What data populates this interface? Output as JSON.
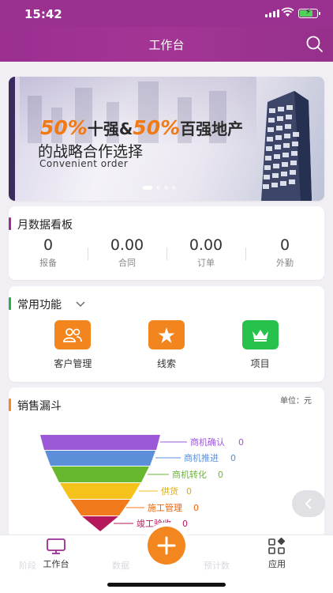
{
  "status_bar": {
    "time": "15:42"
  },
  "header": {
    "title": "工作台"
  },
  "banner": {
    "line1_pct_a": "50%",
    "line1_text_a": "十强&",
    "line1_pct_b": "50%",
    "line1_text_b": "百强地产",
    "line2": "的战略合作选择",
    "subtitle": "Convenient order"
  },
  "monthly": {
    "title": "月数据看板",
    "stats": [
      {
        "value": "0",
        "label": "报备"
      },
      {
        "value": "0.00",
        "label": "合同"
      },
      {
        "value": "0.00",
        "label": "订单"
      },
      {
        "value": "0",
        "label": "外勤"
      }
    ]
  },
  "common": {
    "title": "常用功能",
    "items": [
      {
        "label": "客户管理",
        "icon": "people-icon",
        "color": "#f2851e"
      },
      {
        "label": "线索",
        "icon": "person-star-icon",
        "color": "#f2851e"
      },
      {
        "label": "项目",
        "icon": "crown-icon",
        "color": "#27c24c"
      }
    ]
  },
  "funnel": {
    "title": "销售漏斗",
    "unit": "单位：元",
    "stages": [
      {
        "label": "商机确认",
        "value": "0",
        "color": "#9b59d8"
      },
      {
        "label": "商机推进",
        "value": "0",
        "color": "#5b8fd9"
      },
      {
        "label": "商机转化",
        "value": "0",
        "color": "#67b82f"
      },
      {
        "label": "供货",
        "value": "0",
        "color": "#f5c11b"
      },
      {
        "label": "施工管理",
        "value": "0",
        "color": "#f17a1d"
      },
      {
        "label": "竣工验收",
        "value": "0",
        "color": "#b5195b"
      }
    ]
  },
  "tabbar": {
    "tabs": [
      {
        "label": "工作台",
        "icon": "monitor-icon",
        "active": true
      },
      {
        "label": "应用",
        "icon": "apps-icon",
        "active": false
      }
    ],
    "ghost_labels": [
      "阶段",
      "数据",
      "预计数"
    ],
    "center_icon": "plus-icon"
  }
}
